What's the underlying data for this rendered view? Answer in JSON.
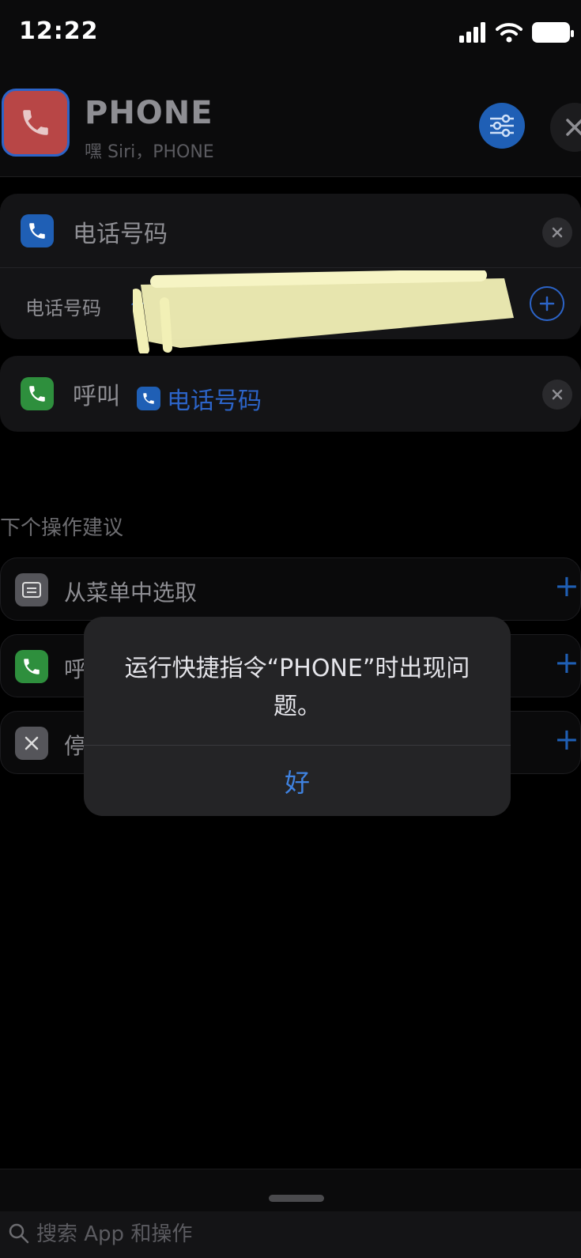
{
  "status_bar": {
    "time": "12:22"
  },
  "header": {
    "title": "PHONE",
    "subtitle": "嘿 Siri，PHONE"
  },
  "actions": [
    {
      "label": "电话号码",
      "field_label": "电话号码",
      "field_hint": "~"
    },
    {
      "label": "呼叫",
      "variable": "电话号码"
    }
  ],
  "suggestions": {
    "title": "下个操作建议",
    "items": [
      {
        "label": "从菜单中选取"
      },
      {
        "label": "呼"
      },
      {
        "label": "停"
      }
    ]
  },
  "dialog": {
    "message": "运行快捷指令“PHONE”时出现问题。",
    "button": "好"
  },
  "search": {
    "placeholder": "搜索 App 和操作"
  },
  "colors": {
    "accent": "#2c64c8",
    "icon_red": "#b84646",
    "icon_green": "#2e8f3d",
    "scribble": "#f4f2b8"
  }
}
